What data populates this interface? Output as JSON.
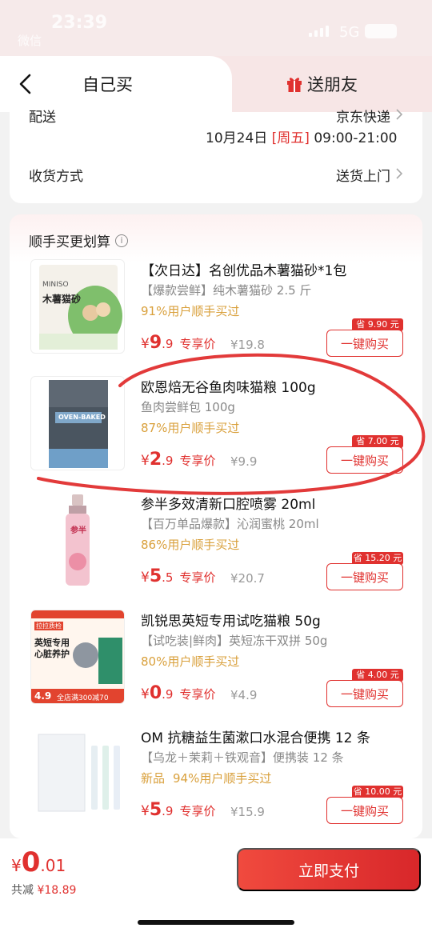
{
  "status_bar": {
    "time": "23:39",
    "carrier": "微信",
    "network": "5G"
  },
  "tabs": {
    "self": "自己买",
    "friend": "送朋友"
  },
  "delivery": {
    "label": "配送",
    "carrier": "京东快递",
    "date": "10月24日",
    "weekday": "[周五]",
    "time": "09:00-21:00",
    "method_label": "收货方式",
    "method_value": "送货上门"
  },
  "recommend": {
    "title": "顺手买更划算",
    "currency": "¥",
    "tag": "专享价",
    "buy_label": "一键购买",
    "products": [
      {
        "name": "【次日达】名创优品木薯猫砂*1包",
        "sub": "【爆款尝鲜】纯木薯猫砂 2.5 斤",
        "new": "",
        "stat": "91%用户顺手买过",
        "price_int": "9",
        "price_dec": ".9",
        "orig": "¥19.8",
        "save": "省 9.90 元"
      },
      {
        "name": "欧恩焙无谷鱼肉味猫粮 100g",
        "sub": "鱼肉尝鲜包 100g",
        "new": "",
        "stat": "87%用户顺手买过",
        "price_int": "2",
        "price_dec": ".9",
        "orig": "¥9.9",
        "save": "省 7.00 元"
      },
      {
        "name": "参半多效清新口腔喷雾 20ml",
        "sub": "【百万单品爆款】沁润蜜桃 20ml",
        "new": "",
        "stat": "86%用户顺手买过",
        "price_int": "5",
        "price_dec": ".5",
        "orig": "¥20.7",
        "save": "省 15.20 元"
      },
      {
        "name": "凯锐思英短专用试吃猫粮 50g",
        "sub": "【试吃装|鲜肉】英短冻干双拼 50g",
        "new": "",
        "stat": "80%用户顺手买过",
        "price_int": "0",
        "price_dec": ".9",
        "orig": "¥4.9",
        "save": "省 4.00 元"
      },
      {
        "name": "OM 抗糖益生菌漱口水混合便携 12 条",
        "sub": "【乌龙＋茉莉＋铁观音】便携装 12 条",
        "new": "新品",
        "stat": "94%用户顺手买过",
        "price_int": "5",
        "price_dec": ".9",
        "orig": "¥15.9",
        "save": "省 10.00 元"
      }
    ],
    "thumb_text": {
      "litter_brand": "MINISO",
      "litter_title": "木薯猫砂",
      "food_brand": "OVEN-BAKED",
      "spray_brand": "参半",
      "kairuisi_badge": "拉拉质检",
      "kairuisi_line1": "英短专用",
      "kairuisi_line2": "心脏养护",
      "kairuisi_price": "4.9",
      "kairuisi_promo": "全店满300减70"
    }
  },
  "checkout": {
    "currency": "¥",
    "total_int": "0",
    "total_dec": ".01",
    "saved_label": "共减",
    "saved_value": "¥18.89",
    "pay_label": "立即支付"
  }
}
